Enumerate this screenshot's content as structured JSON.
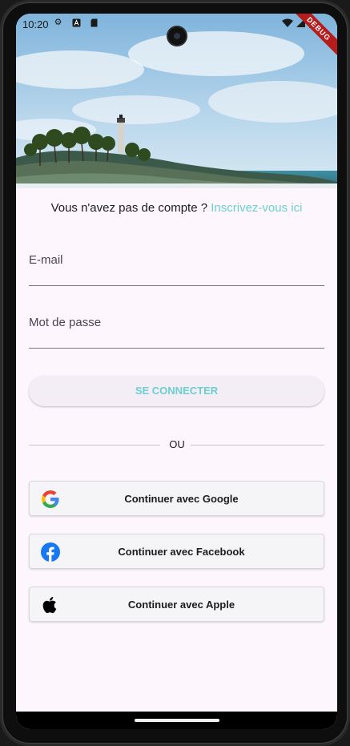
{
  "status_bar": {
    "time": "10:20",
    "icons": [
      "gear-icon",
      "notification-a-icon",
      "sd-card-icon",
      "wifi-icon",
      "signal-icon",
      "battery-icon"
    ],
    "debug_banner": "DEBUG"
  },
  "signup_prompt": {
    "text": "Vous n'avez pas de compte ? ",
    "link": "Inscrivez-vous ici"
  },
  "form": {
    "email_label": "E-mail",
    "password_label": "Mot de passe",
    "login_button": "SE CONNECTER"
  },
  "divider": {
    "text": "OU"
  },
  "social_buttons": [
    {
      "icon": "google-icon",
      "label": "Continuer avec Google"
    },
    {
      "icon": "facebook-icon",
      "label": "Continuer avec Facebook"
    },
    {
      "icon": "apple-icon",
      "label": "Continuer avec Apple"
    }
  ],
  "colors": {
    "accent": "#6ccfd0",
    "background": "#fdf7fd",
    "button_bg": "#f3edf6"
  }
}
